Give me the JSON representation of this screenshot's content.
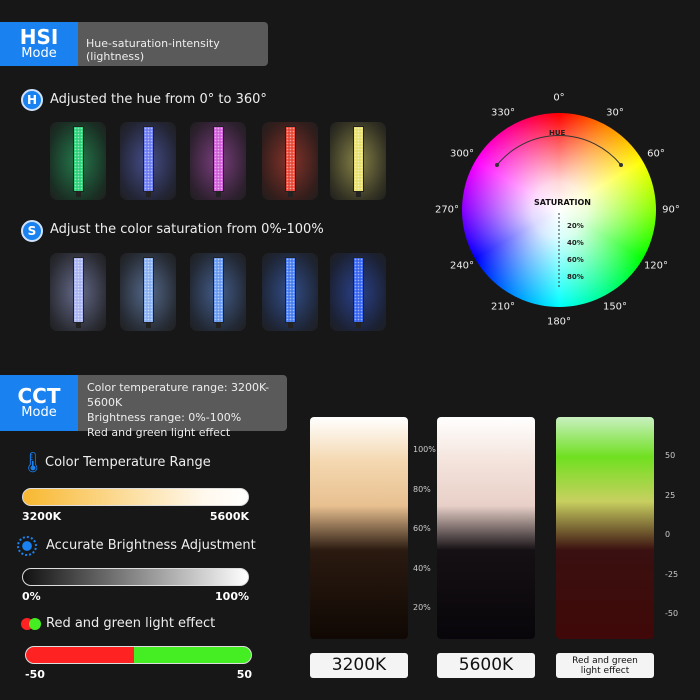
{
  "hsi": {
    "title": "HSI",
    "subtitle": "Mode",
    "description": "Hue-saturation-intensity (lightness)",
    "hue_badge": "H",
    "hue_heading": "Adjusted the hue from 0° to 360°",
    "sat_badge": "S",
    "sat_heading": "Adjust the color saturation from 0%-100%",
    "hue_colors": [
      "#2fd07a",
      "#6e7ef0",
      "#d060d8",
      "#e84a3a",
      "#e8e070"
    ],
    "sat_colors": [
      "#aab4f0",
      "#8ab0f0",
      "#6a9af0",
      "#4a7ef0",
      "#3a66f0"
    ]
  },
  "wheel": {
    "hue_label": "HUE",
    "saturation_label": "SATURATION",
    "angles": [
      "0°",
      "30°",
      "60°",
      "90°",
      "120°",
      "150°",
      "180°",
      "210°",
      "240°",
      "270°",
      "300°",
      "330°"
    ],
    "saturation_ticks": [
      "20%",
      "40%",
      "60%",
      "80%"
    ]
  },
  "cct": {
    "title": "CCT",
    "subtitle": "Mode",
    "lines": [
      "Color temperature range: 3200K-5600K",
      "Brightness range: 0%-100%",
      "Red and green light effect"
    ],
    "temp_heading": "Color Temperature Range",
    "temp_min": "3200K",
    "temp_max": "5600K",
    "bright_heading": "Accurate Brightness Adjustment",
    "bright_min": "0%",
    "bright_max": "100%",
    "rg_heading": "Red and green  light effect",
    "rg_min": "-50",
    "rg_max": "50"
  },
  "photos": {
    "labels": [
      "3200K",
      "5600K",
      "Red and green light effect"
    ],
    "brightness_scale": [
      "100%",
      "80%",
      "60%",
      "40%",
      "20%"
    ],
    "rg_scale": [
      "50",
      "25",
      "0",
      "-25",
      "-50"
    ]
  }
}
